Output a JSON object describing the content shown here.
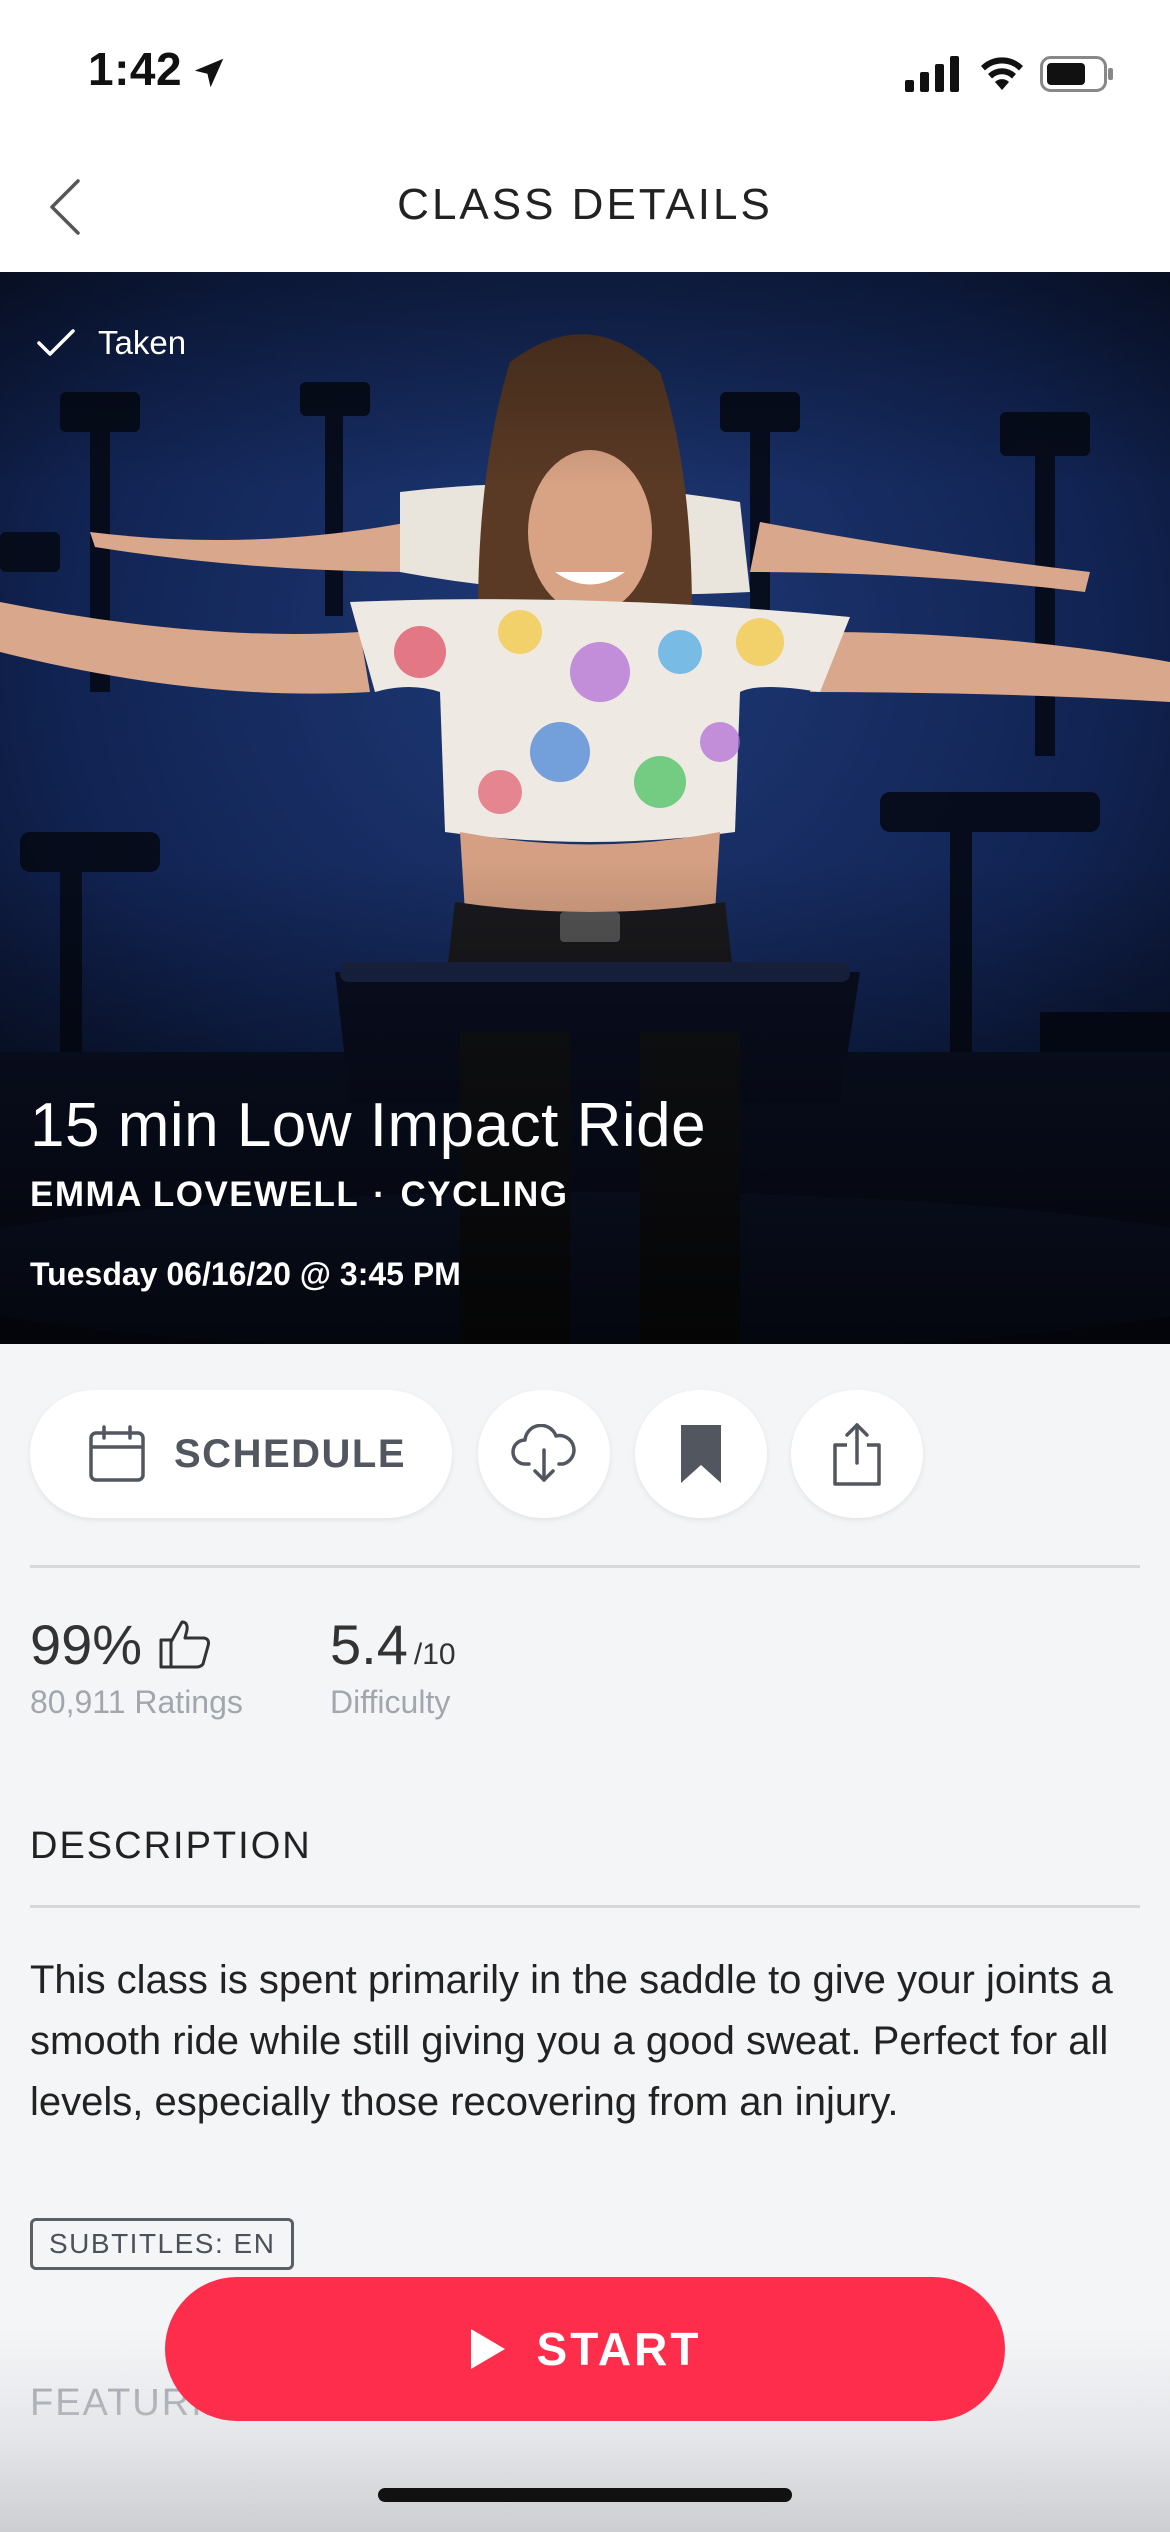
{
  "status_bar": {
    "time": "1:42"
  },
  "header": {
    "title": "CLASS DETAILS"
  },
  "hero": {
    "badge": "Taken",
    "class_title": "15 min Low Impact Ride",
    "instructor": "EMMA LOVEWELL",
    "separator": "·",
    "category": "CYCLING",
    "date": "Tuesday 06/16/20 @ 3:45 PM"
  },
  "actions": {
    "schedule_label": "SCHEDULE",
    "icons": [
      "calendar-icon",
      "download-cloud-icon",
      "bookmark-icon",
      "share-icon"
    ]
  },
  "stats": {
    "rating_percent": "99%",
    "ratings_count": "80,911 Ratings",
    "difficulty_value": "5.4",
    "difficulty_scale": "/10",
    "difficulty_label": "Difficulty"
  },
  "description": {
    "heading": "DESCRIPTION",
    "text": "This class is spent primarily in the saddle to give your joints a smooth ride while still giving you a good sweat. Perfect for all levels, especially those recovering from an injury.",
    "subtitles_badge": "SUBTITLES: EN"
  },
  "featured": {
    "heading": "FEATURING MUSIC BY"
  },
  "start_button": {
    "label": "START"
  },
  "colors": {
    "accent": "#fd2d4b",
    "background": "#f4f5f7",
    "hero_dark": "#0c1530"
  }
}
